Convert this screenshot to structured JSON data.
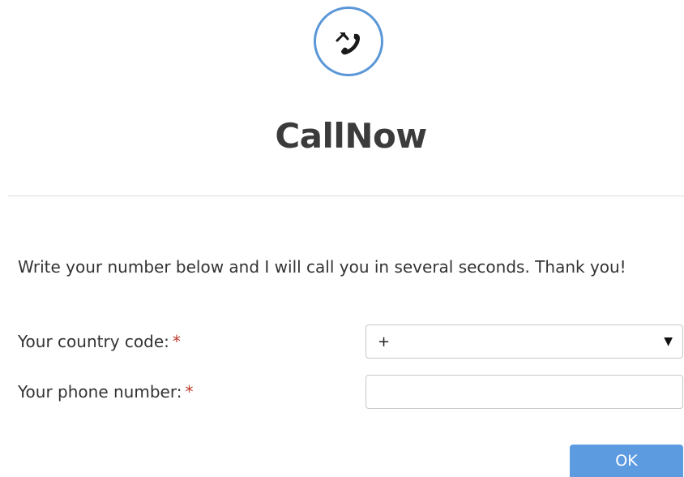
{
  "app": {
    "title": "CallNow",
    "logo_icon": "phone-callback-icon",
    "accent_color": "#5b97d8"
  },
  "form": {
    "intro_text": "Write your number below and I will call you in several seconds. Thank you!",
    "country_code": {
      "label": "Your country code:",
      "required_mark": "*",
      "selected_value": "+",
      "arrow_glyph": "▼"
    },
    "phone_number": {
      "label": "Your phone number:",
      "required_mark": "*",
      "value": ""
    },
    "submit_label": "OK"
  },
  "colors": {
    "required": "#c0392b",
    "button": "#5d9be0",
    "divider": "#dcdcdc"
  }
}
